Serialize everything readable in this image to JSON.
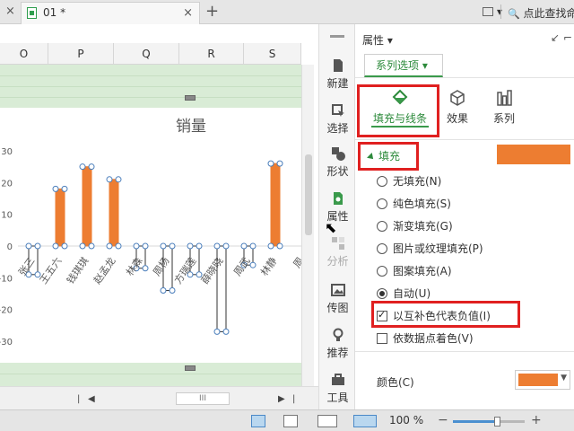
{
  "tabbar": {
    "doc_title": "01 *",
    "close_glyph": "×",
    "plus_glyph": "+",
    "search_hint": "点此查找命"
  },
  "sheet": {
    "columns": [
      "O",
      "P",
      "Q",
      "R",
      "S"
    ]
  },
  "chart_data": {
    "type": "bar",
    "title": "销量",
    "categories": [
      "张三",
      "王五六",
      "钱琪琪",
      "赵孟龙",
      "林森",
      "周杨",
      "方瑞莲",
      "薛晓晓",
      "周武",
      "林静",
      "周"
    ],
    "values": [
      -9,
      18,
      25,
      21,
      -7,
      -14,
      -9,
      -27,
      -6,
      26,
      null
    ],
    "ylim": [
      -30,
      30
    ],
    "yticks": [
      "30",
      "20",
      "10",
      "0",
      "-10",
      "-20",
      "-30"
    ],
    "positive_color": "#ed7d31",
    "negative_color": "#ffffff"
  },
  "toolstrip": {
    "items": [
      {
        "label": "新建",
        "icon": "new-icon"
      },
      {
        "label": "选择",
        "icon": "select-icon"
      },
      {
        "label": "形状",
        "icon": "shape-icon"
      },
      {
        "label": "属性",
        "icon": "property-icon"
      },
      {
        "label": "分析",
        "icon": "analysis-icon"
      },
      {
        "label": "传图",
        "icon": "upload-image-icon"
      },
      {
        "label": "推荐",
        "icon": "recommend-icon"
      },
      {
        "label": "工具",
        "icon": "tools-icon"
      }
    ]
  },
  "panel": {
    "title": "属性 ▾",
    "series_tab": "系列选项 ▾",
    "subtabs": [
      "填充与线条",
      "效果",
      "系列"
    ],
    "section": "填充",
    "fill_options": [
      "无填充(N)",
      "纯色填充(S)",
      "渐变填充(G)",
      "图片或纹理填充(P)",
      "图案填充(A)",
      "自动(U)"
    ],
    "selected_fill": "自动(U)",
    "invert_if_negative": "以互补色代表负值(I)",
    "vary_colors": "依数据点着色(V)",
    "color_label": "颜色(C)",
    "fill_color": "#ed7d31"
  },
  "status": {
    "zoom": "100 %",
    "minus": "−",
    "plus": "+"
  }
}
